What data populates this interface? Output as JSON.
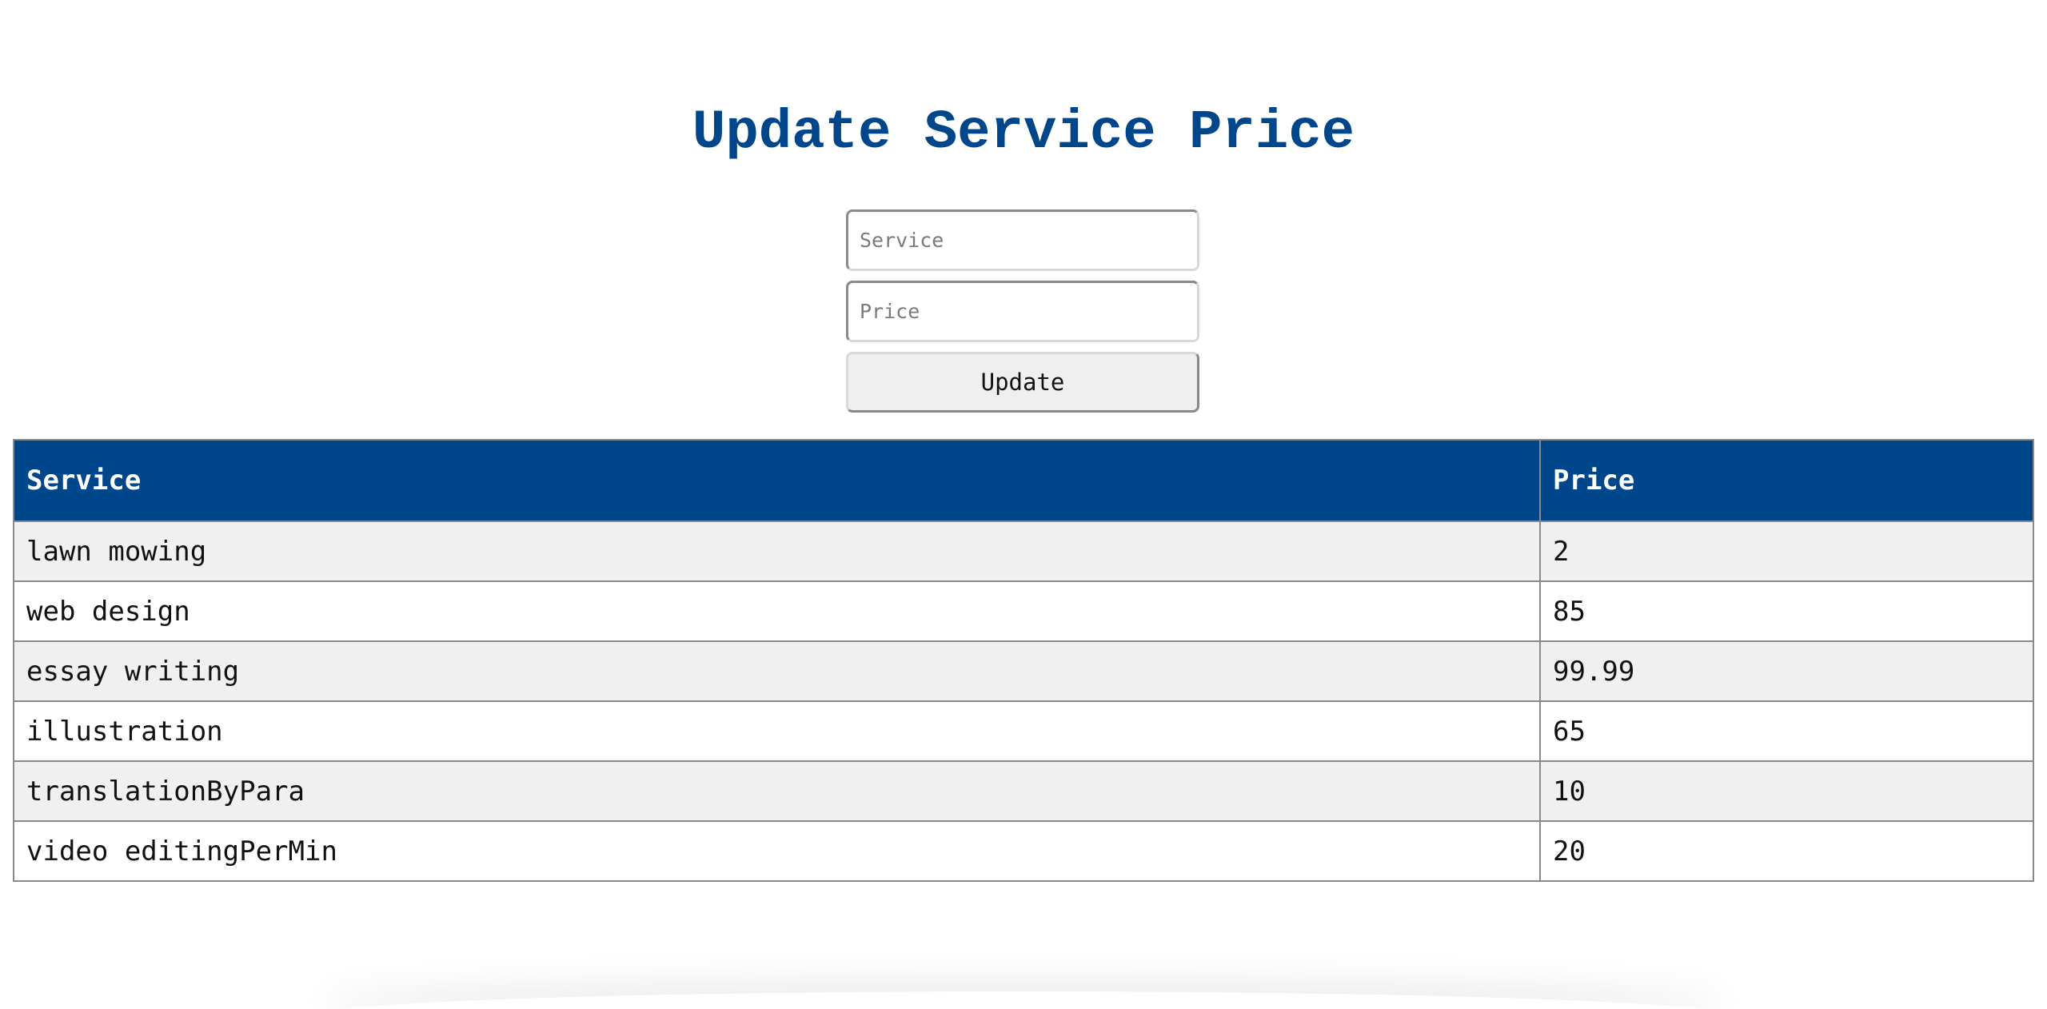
{
  "page": {
    "title": "Update Service Price"
  },
  "form": {
    "service_placeholder": "Service",
    "service_value": "",
    "price_placeholder": "Price",
    "price_value": "",
    "update_label": "Update"
  },
  "table": {
    "headers": [
      "Service",
      "Price"
    ],
    "rows": [
      [
        "lawn mowing",
        "2"
      ],
      [
        "web design",
        "85"
      ],
      [
        "essay writing",
        "99.99"
      ],
      [
        "illustration",
        "65"
      ],
      [
        "translationByPara",
        "10"
      ],
      [
        "video editingPerMin",
        "20"
      ]
    ]
  },
  "colors": {
    "accent": "#00468b",
    "row_alt": "#f0f0f0"
  }
}
